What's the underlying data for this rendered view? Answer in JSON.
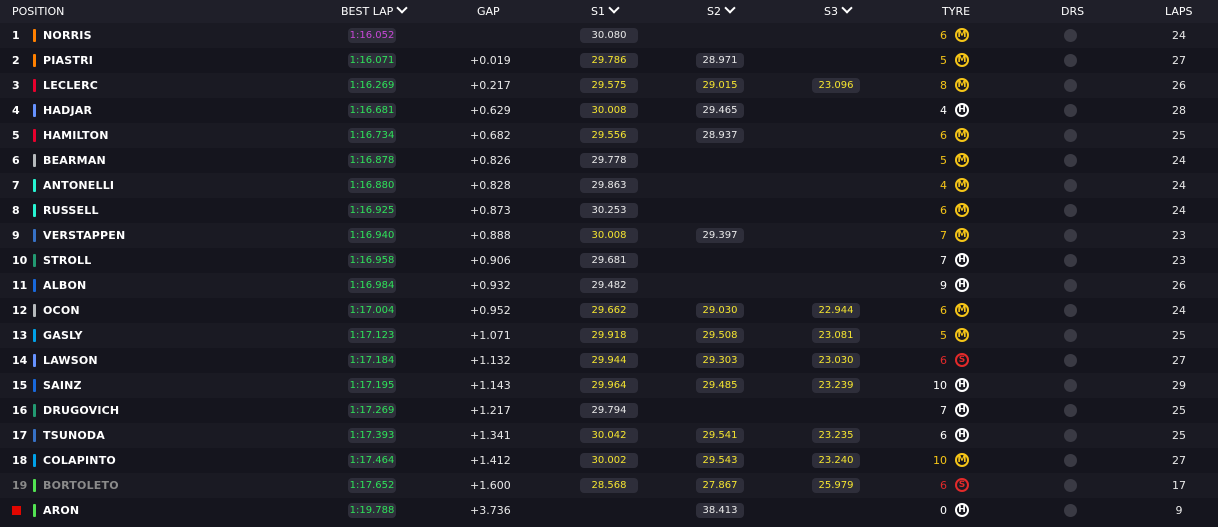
{
  "header": {
    "position": "POSITION",
    "best_lap": "BEST LAP",
    "gap": "GAP",
    "s1": "S1",
    "s2": "S2",
    "s3": "S3",
    "tyre": "TYRE",
    "drs": "DRS",
    "laps": "LAPS"
  },
  "colors": {
    "personal_best": "#2ee25a",
    "overall_fastest": "#c848d8",
    "sector_best": "#f4e430",
    "medium": "#f5c518",
    "hard": "#ffffff",
    "soft": "#e32a2a"
  },
  "rows": [
    {
      "pos": "1",
      "name": "NORRIS",
      "team_color": "#ff8000",
      "best": "1:16.052",
      "best_fastest": true,
      "gap": "",
      "s1": "30.080",
      "s1_pb": false,
      "s2": "",
      "s2_pb": false,
      "s3": "",
      "s3_pb": false,
      "tyre": "M",
      "tyre_age": "6",
      "laps": "24"
    },
    {
      "pos": "2",
      "name": "PIASTRI",
      "team_color": "#ff8000",
      "best": "1:16.071",
      "best_fastest": false,
      "gap": "+0.019",
      "s1": "29.786",
      "s1_pb": true,
      "s2": "28.971",
      "s2_pb": false,
      "s3": "",
      "s3_pb": false,
      "tyre": "M",
      "tyre_age": "5",
      "laps": "27"
    },
    {
      "pos": "3",
      "name": "LECLERC",
      "team_color": "#e8002d",
      "best": "1:16.269",
      "best_fastest": false,
      "gap": "+0.217",
      "s1": "29.575",
      "s1_pb": true,
      "s2": "29.015",
      "s2_pb": true,
      "s3": "23.096",
      "s3_pb": true,
      "tyre": "M",
      "tyre_age": "8",
      "laps": "26"
    },
    {
      "pos": "4",
      "name": "HADJAR",
      "team_color": "#6692ff",
      "best": "1:16.681",
      "best_fastest": false,
      "gap": "+0.629",
      "s1": "30.008",
      "s1_pb": true,
      "s2": "29.465",
      "s2_pb": false,
      "s3": "",
      "s3_pb": false,
      "tyre": "H",
      "tyre_age": "4",
      "laps": "28"
    },
    {
      "pos": "5",
      "name": "HAMILTON",
      "team_color": "#e8002d",
      "best": "1:16.734",
      "best_fastest": false,
      "gap": "+0.682",
      "s1": "29.556",
      "s1_pb": true,
      "s2": "28.937",
      "s2_pb": false,
      "s3": "",
      "s3_pb": false,
      "tyre": "M",
      "tyre_age": "6",
      "laps": "25"
    },
    {
      "pos": "6",
      "name": "BEARMAN",
      "team_color": "#b6babd",
      "best": "1:16.878",
      "best_fastest": false,
      "gap": "+0.826",
      "s1": "29.778",
      "s1_pb": false,
      "s2": "",
      "s2_pb": false,
      "s3": "",
      "s3_pb": false,
      "tyre": "M",
      "tyre_age": "5",
      "laps": "24"
    },
    {
      "pos": "7",
      "name": "ANTONELLI",
      "team_color": "#27f4d2",
      "best": "1:16.880",
      "best_fastest": false,
      "gap": "+0.828",
      "s1": "29.863",
      "s1_pb": false,
      "s2": "",
      "s2_pb": false,
      "s3": "",
      "s3_pb": false,
      "tyre": "M",
      "tyre_age": "4",
      "laps": "24"
    },
    {
      "pos": "8",
      "name": "RUSSELL",
      "team_color": "#27f4d2",
      "best": "1:16.925",
      "best_fastest": false,
      "gap": "+0.873",
      "s1": "30.253",
      "s1_pb": false,
      "s2": "",
      "s2_pb": false,
      "s3": "",
      "s3_pb": false,
      "tyre": "M",
      "tyre_age": "6",
      "laps": "24"
    },
    {
      "pos": "9",
      "name": "VERSTAPPEN",
      "team_color": "#3671c6",
      "best": "1:16.940",
      "best_fastest": false,
      "gap": "+0.888",
      "s1": "30.008",
      "s1_pb": true,
      "s2": "29.397",
      "s2_pb": false,
      "s3": "",
      "s3_pb": false,
      "tyre": "M",
      "tyre_age": "7",
      "laps": "23"
    },
    {
      "pos": "10",
      "name": "STROLL",
      "team_color": "#229971",
      "best": "1:16.958",
      "best_fastest": false,
      "gap": "+0.906",
      "s1": "29.681",
      "s1_pb": false,
      "s2": "",
      "s2_pb": false,
      "s3": "",
      "s3_pb": false,
      "tyre": "H",
      "tyre_age": "7",
      "laps": "23"
    },
    {
      "pos": "11",
      "name": "ALBON",
      "team_color": "#1868db",
      "best": "1:16.984",
      "best_fastest": false,
      "gap": "+0.932",
      "s1": "29.482",
      "s1_pb": false,
      "s2": "",
      "s2_pb": false,
      "s3": "",
      "s3_pb": false,
      "tyre": "H",
      "tyre_age": "9",
      "laps": "26"
    },
    {
      "pos": "12",
      "name": "OCON",
      "team_color": "#b6babd",
      "best": "1:17.004",
      "best_fastest": false,
      "gap": "+0.952",
      "s1": "29.662",
      "s1_pb": true,
      "s2": "29.030",
      "s2_pb": true,
      "s3": "22.944",
      "s3_pb": true,
      "tyre": "M",
      "tyre_age": "6",
      "laps": "24"
    },
    {
      "pos": "13",
      "name": "GASLY",
      "team_color": "#00a1e8",
      "best": "1:17.123",
      "best_fastest": false,
      "gap": "+1.071",
      "s1": "29.918",
      "s1_pb": true,
      "s2": "29.508",
      "s2_pb": true,
      "s3": "23.081",
      "s3_pb": true,
      "tyre": "M",
      "tyre_age": "5",
      "laps": "25"
    },
    {
      "pos": "14",
      "name": "LAWSON",
      "team_color": "#6692ff",
      "best": "1:17.184",
      "best_fastest": false,
      "gap": "+1.132",
      "s1": "29.944",
      "s1_pb": true,
      "s2": "29.303",
      "s2_pb": true,
      "s3": "23.030",
      "s3_pb": true,
      "tyre": "S",
      "tyre_age": "6",
      "laps": "27"
    },
    {
      "pos": "15",
      "name": "SAINZ",
      "team_color": "#1868db",
      "best": "1:17.195",
      "best_fastest": false,
      "gap": "+1.143",
      "s1": "29.964",
      "s1_pb": true,
      "s2": "29.485",
      "s2_pb": true,
      "s3": "23.239",
      "s3_pb": true,
      "tyre": "H",
      "tyre_age": "10",
      "laps": "29"
    },
    {
      "pos": "16",
      "name": "DRUGOVICH",
      "team_color": "#229971",
      "best": "1:17.269",
      "best_fastest": false,
      "gap": "+1.217",
      "s1": "29.794",
      "s1_pb": false,
      "s2": "",
      "s2_pb": false,
      "s3": "",
      "s3_pb": false,
      "tyre": "H",
      "tyre_age": "7",
      "laps": "25"
    },
    {
      "pos": "17",
      "name": "TSUNODA",
      "team_color": "#3671c6",
      "best": "1:17.393",
      "best_fastest": false,
      "gap": "+1.341",
      "s1": "30.042",
      "s1_pb": true,
      "s2": "29.541",
      "s2_pb": true,
      "s3": "23.235",
      "s3_pb": true,
      "tyre": "H",
      "tyre_age": "6",
      "laps": "25"
    },
    {
      "pos": "18",
      "name": "COLAPINTO",
      "team_color": "#00a1e8",
      "best": "1:17.464",
      "best_fastest": false,
      "gap": "+1.412",
      "s1": "30.002",
      "s1_pb": true,
      "s2": "29.543",
      "s2_pb": true,
      "s3": "23.240",
      "s3_pb": true,
      "tyre": "M",
      "tyre_age": "10",
      "laps": "27"
    },
    {
      "pos": "19",
      "name": "BORTOLETO",
      "team_color": "#52e252",
      "best": "1:17.652",
      "best_fastest": false,
      "gap": "+1.600",
      "s1": "28.568",
      "s1_pb": true,
      "s2": "27.867",
      "s2_pb": true,
      "s3": "25.979",
      "s3_pb": true,
      "tyre": "S",
      "tyre_age": "6",
      "laps": "17",
      "retired": true
    },
    {
      "pos": "",
      "name": "ARON",
      "team_color": "#52e252",
      "best": "1:19.788",
      "best_fastest": false,
      "gap": "+3.736",
      "s1": "",
      "s1_pb": false,
      "s2": "38.413",
      "s2_pb": false,
      "s3": "",
      "s3_pb": false,
      "tyre": "H",
      "tyre_age": "0",
      "laps": "9",
      "flagged": true
    }
  ]
}
